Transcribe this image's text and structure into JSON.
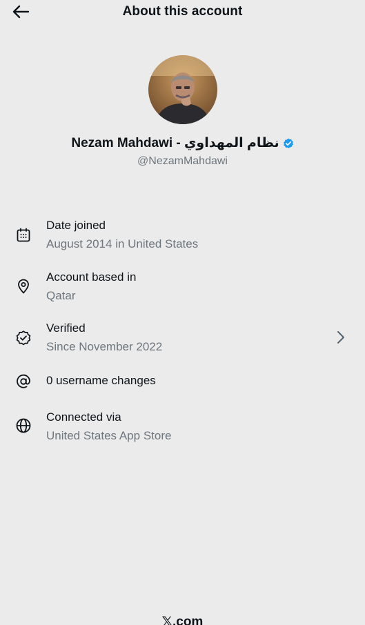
{
  "header": {
    "title": "About this account"
  },
  "profile": {
    "name": "Nezam Mahdawi - نظام المهداوي",
    "handle": "@NezamMahdawi",
    "verified_color": "#1d9bf0"
  },
  "details": [
    {
      "icon": "calendar-icon",
      "label": "Date joined",
      "value": "August 2014 in United States"
    },
    {
      "icon": "location-pin-icon",
      "label": "Account based in",
      "value": "Qatar"
    },
    {
      "icon": "verified-check-icon",
      "label": "Verified",
      "value": "Since November 2022"
    },
    {
      "icon": "at-sign-icon",
      "label": "0 username changes",
      "value": ""
    },
    {
      "icon": "globe-icon",
      "label": "Connected via",
      "value": "United States App Store"
    }
  ],
  "footer": {
    "brand": "𝕏.com"
  }
}
